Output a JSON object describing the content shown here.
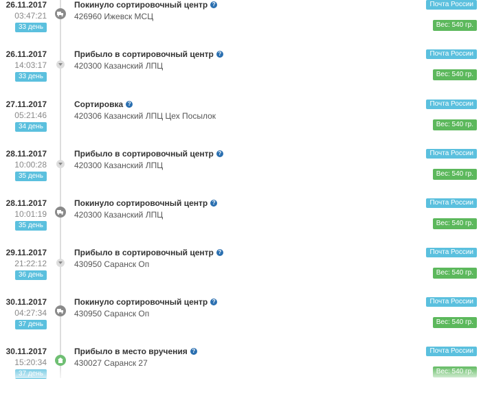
{
  "events": [
    {
      "date": "26.11.2017",
      "time": "03:47:21",
      "day": "33 день",
      "title": "Покинуло сортировочный центр",
      "place": "426960 Ижевск МСЦ",
      "carrier": "Почта России",
      "weight": "Вес: 540 гр.",
      "icon": "truck-icon"
    },
    {
      "date": "26.11.2017",
      "time": "14:03:17",
      "day": "33 день",
      "title": "Прибыло в сортировочный центр",
      "place": "420300 Казанский ЛПЦ",
      "carrier": "Почта России",
      "weight": "Вес: 540 гр.",
      "icon": "arrow-down-icon"
    },
    {
      "date": "27.11.2017",
      "time": "05:21:46",
      "day": "34 день",
      "title": "Сортировка",
      "place": "420306 Казанский ЛПЦ Цех Посылок",
      "carrier": "Почта России",
      "weight": "Вес: 540 гр.",
      "icon": "none"
    },
    {
      "date": "28.11.2017",
      "time": "10:00:28",
      "day": "35 день",
      "title": "Прибыло в сортировочный центр",
      "place": "420300 Казанский ЛПЦ",
      "carrier": "Почта России",
      "weight": "Вес: 540 гр.",
      "icon": "arrow-down-icon"
    },
    {
      "date": "28.11.2017",
      "time": "10:01:19",
      "day": "35 день",
      "title": "Покинуло сортировочный центр",
      "place": "420300 Казанский ЛПЦ",
      "carrier": "Почта России",
      "weight": "Вес: 540 гр.",
      "icon": "truck-icon"
    },
    {
      "date": "29.11.2017",
      "time": "21:22:12",
      "day": "36 день",
      "title": "Прибыло в сортировочный центр",
      "place": "430950 Саранск Оп",
      "carrier": "Почта России",
      "weight": "Вес: 540 гр.",
      "icon": "arrow-down-icon"
    },
    {
      "date": "30.11.2017",
      "time": "04:27:34",
      "day": "37 день",
      "title": "Покинуло сортировочный центр",
      "place": "430950 Саранск Оп",
      "carrier": "Почта России",
      "weight": "Вес: 540 гр.",
      "icon": "truck-icon"
    },
    {
      "date": "30.11.2017",
      "time": "15:20:34",
      "day": "37 день",
      "title": "Прибыло в место вручения",
      "place": "430027 Саранск 27",
      "carrier": "Почта России",
      "weight": "Вес: 540 гр.",
      "icon": "post-office-icon"
    }
  ],
  "help_icon": "?",
  "colors": {
    "day_badge": "#5bc0de",
    "carrier_badge": "#5bc0de",
    "weight_badge": "#5cb85c",
    "help_icon": "#2a6fb0"
  }
}
